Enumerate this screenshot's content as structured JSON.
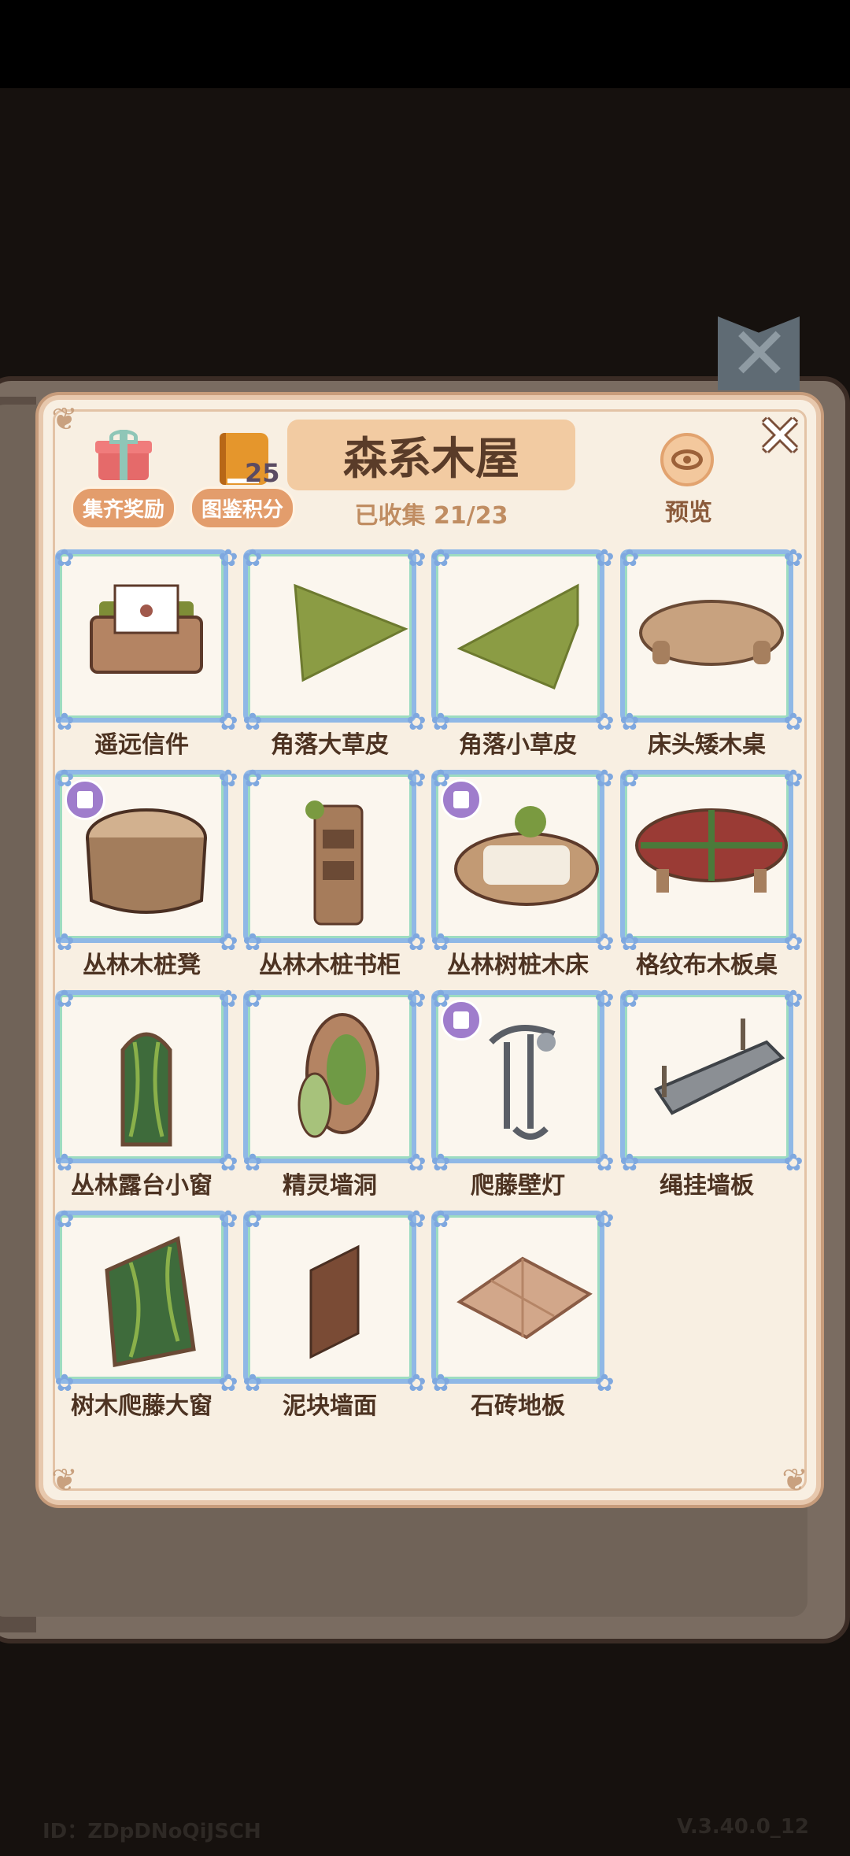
{
  "header": {
    "title": "森系木屋",
    "collected": "已收集 21/23",
    "reward_label": "集齐奖励",
    "codex_label": "图鉴积分",
    "codex_points": "25",
    "preview_label": "预览"
  },
  "items": [
    {
      "name": "遥远信件",
      "badge": false,
      "art": "letter-box"
    },
    {
      "name": "角落大草皮",
      "badge": false,
      "art": "big-grass-corner"
    },
    {
      "name": "角落小草皮",
      "badge": false,
      "art": "small-grass-corner"
    },
    {
      "name": "床头矮木桌",
      "badge": false,
      "art": "low-wood-table"
    },
    {
      "name": "丛林木桩凳",
      "badge": true,
      "art": "stump-stool"
    },
    {
      "name": "丛林木桩书柜",
      "badge": false,
      "art": "stump-bookshelf"
    },
    {
      "name": "丛林树桩木床",
      "badge": true,
      "art": "stump-bed"
    },
    {
      "name": "格纹布木板桌",
      "badge": false,
      "art": "plaid-table"
    },
    {
      "name": "丛林露台小窗",
      "badge": false,
      "art": "jungle-window"
    },
    {
      "name": "精灵墙洞",
      "badge": false,
      "art": "fairy-hole"
    },
    {
      "name": "爬藤壁灯",
      "badge": true,
      "art": "vine-lamp"
    },
    {
      "name": "绳挂墙板",
      "badge": false,
      "art": "rope-shelf"
    },
    {
      "name": "树木爬藤大窗",
      "badge": false,
      "art": "vine-big-window"
    },
    {
      "name": "泥块墙面",
      "badge": false,
      "art": "mud-wall"
    },
    {
      "name": "石砖地板",
      "badge": false,
      "art": "stone-floor"
    }
  ],
  "footer": {
    "id": "ID：ZDpDNoQiJSCH",
    "version": "V.3.40.0_12"
  },
  "colors": {
    "panel_bg": "#f8efe2",
    "frame_blue": "#8fb8e6",
    "accent_orange": "#e39d6c",
    "title_bg": "#f2cba2",
    "badge_purple": "#9f7dcc"
  }
}
